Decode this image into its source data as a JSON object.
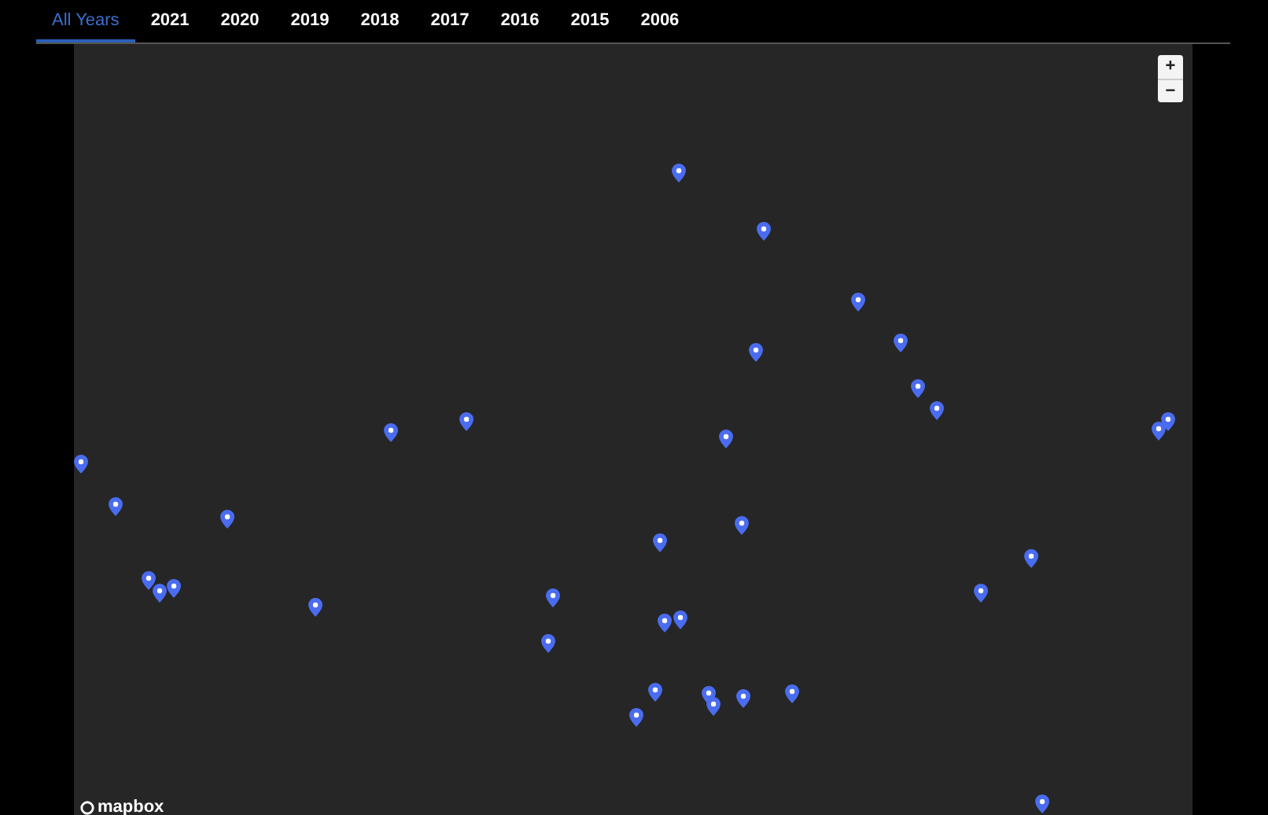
{
  "tabs": [
    {
      "label": "All Years",
      "selected": true
    },
    {
      "label": "2021",
      "selected": false
    },
    {
      "label": "2020",
      "selected": false
    },
    {
      "label": "2019",
      "selected": false
    },
    {
      "label": "2018",
      "selected": false
    },
    {
      "label": "2017",
      "selected": false
    },
    {
      "label": "2016",
      "selected": false
    },
    {
      "label": "2015",
      "selected": false
    },
    {
      "label": "2006",
      "selected": false
    }
  ],
  "map": {
    "zoom_in": "+",
    "zoom_out": "−",
    "logo": "mapbox"
  }
}
